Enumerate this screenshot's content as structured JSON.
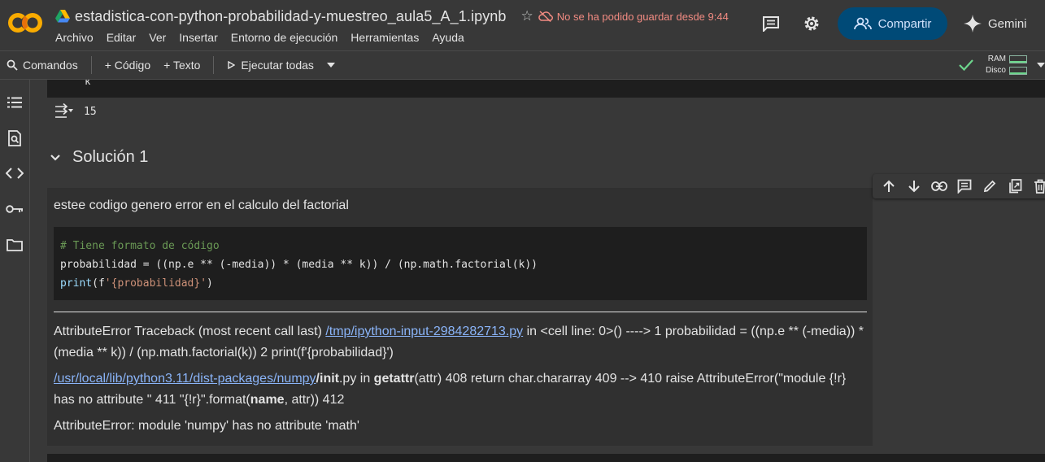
{
  "app": {
    "logo_text": "CO",
    "notebook_title": "estadistica-con-python-probabilidad-y-muestreo_aula5_A_1.ipynb",
    "unsaved_notice": "No se ha podido guardar desde 9:44",
    "share_label": "Compartir",
    "gemini_label": "Gemini"
  },
  "menu": [
    "Archivo",
    "Editar",
    "Ver",
    "Insertar",
    "Entorno de ejecución",
    "Herramientas",
    "Ayuda"
  ],
  "toolbar": {
    "commands": "Comandos",
    "add_code": "+ Código",
    "add_text": "+ Texto",
    "run_all": "Ejecutar todas",
    "ram_label": "RAM",
    "disk_label": "Disco"
  },
  "previous_cell": {
    "code_fragment": "k",
    "output_value": "15"
  },
  "section": {
    "title": "Solución 1"
  },
  "text_cell": {
    "paragraph": "estee codigo genero error en el calculo del factorial",
    "code_lines": {
      "comment": "# Tiene formato de código",
      "line2": "probabilidad = ((np.e ** (-media)) * (media ** k)) / (np.math.factorial(k))",
      "line3_kw": "print",
      "line3_open": "(f",
      "line3_str": "'{probabilidad}'",
      "line3_close": ")"
    },
    "traceback": {
      "p1_a": "AttributeError Traceback (most recent call last) ",
      "p1_link": "/tmp/ipython-input-2984282713.py",
      "p1_b": " in <cell line: 0>() ----> 1 probabilidad = ((np.e ** (-media)) * (media ** k)) / (np.math.factorial(k)) 2 print(f'{probabilidad}')",
      "p2_link": "/usr/local/lib/python3.11/dist-packages/numpy",
      "p2_bold1": "/init",
      "p2_a": ".py in ",
      "p2_bold2": "getattr",
      "p2_b": "(attr) 408 return char.chararray 409 --> 410 raise AttributeError(\"module {!r} has no attribute \" 411 \"{!r}\".format(",
      "p2_bold3": "name",
      "p2_c": ", attr)) 412",
      "p3": "AttributeError: module 'numpy' has no attribute 'math'"
    }
  },
  "colors": {
    "background": "#383838",
    "code_bg": "#1e1e1e",
    "share_bg": "#004a77",
    "link": "#8ab4f8",
    "warning": "#f28b82",
    "ok_green": "#6dd58c"
  }
}
